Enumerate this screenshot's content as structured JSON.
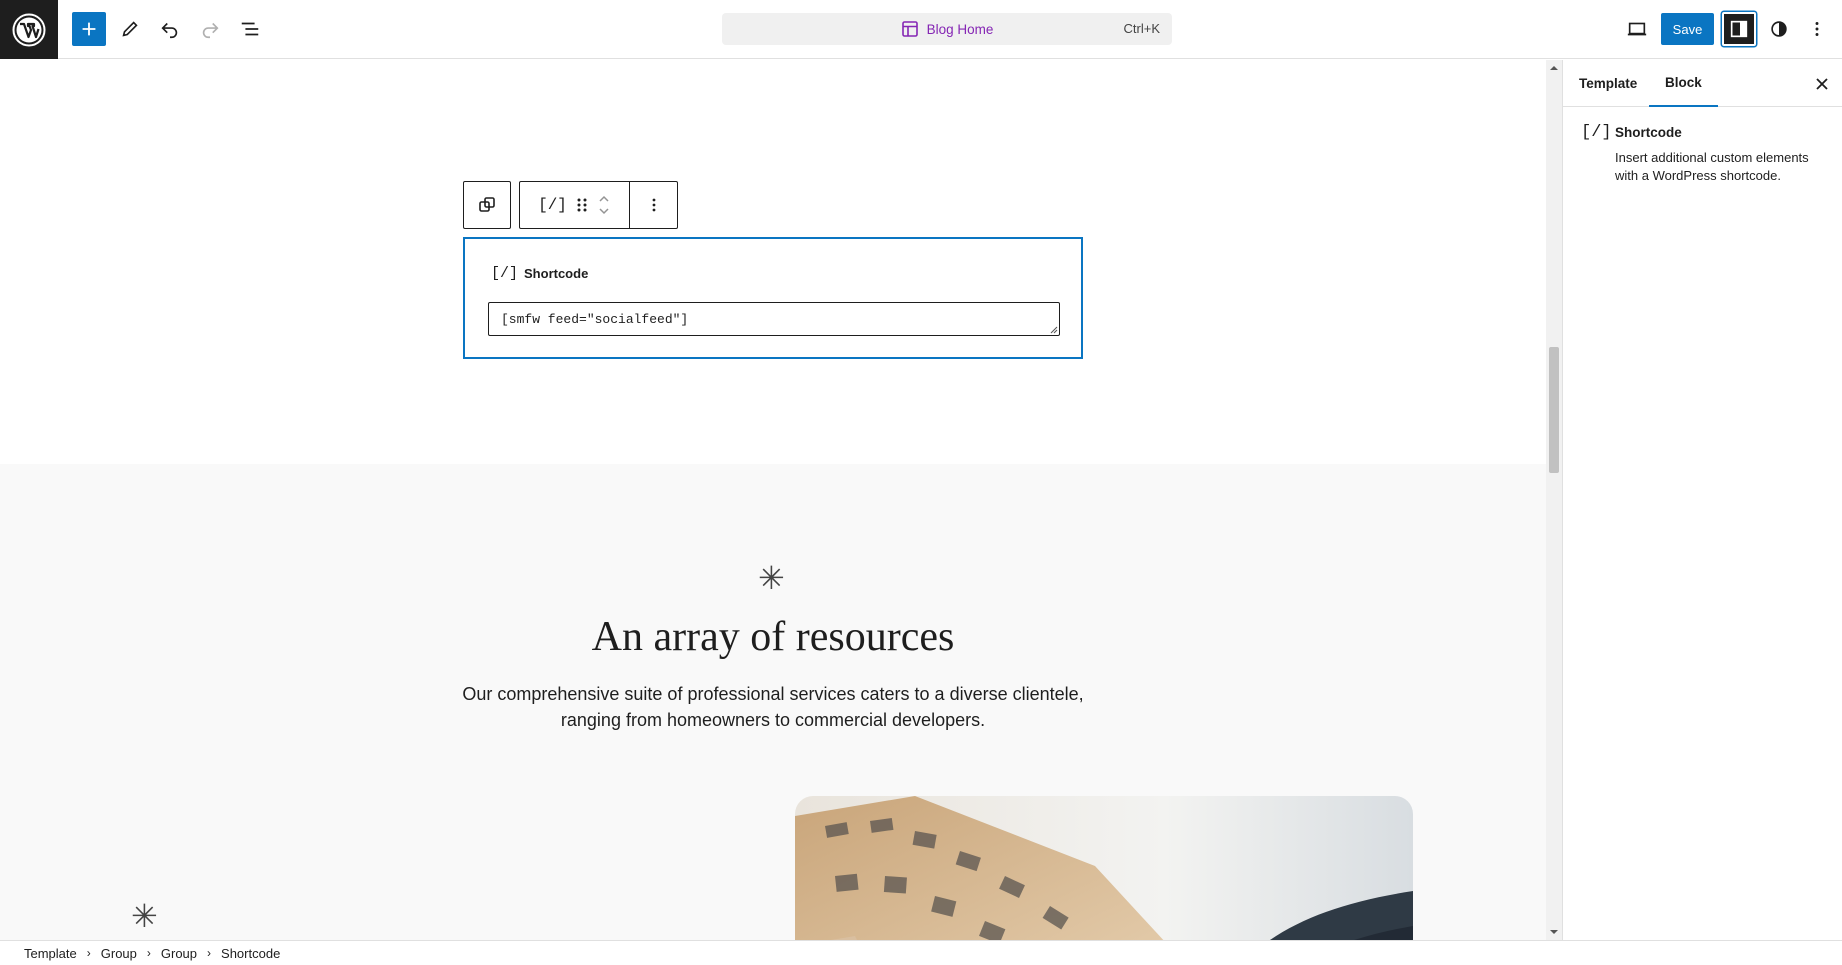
{
  "topbar": {
    "document_title": "Blog Home",
    "shortcut": "Ctrl+K",
    "save_label": "Save"
  },
  "block_toolbar": {
    "block_icon": "[/]"
  },
  "shortcode_block": {
    "icon": "[/]",
    "label": "Shortcode",
    "value": "[smfw feed=\"socialfeed\"]"
  },
  "canvas": {
    "asterisk": "✳",
    "heading": "An array of resources",
    "subtext_line1": "Our comprehensive suite of professional services caters to a diverse clientele,",
    "subtext_line2": "ranging from homeowners to commercial developers."
  },
  "sidebar": {
    "tabs": [
      {
        "label": "Template",
        "active": false
      },
      {
        "label": "Block",
        "active": true
      }
    ],
    "block_card": {
      "icon": "[/]",
      "title": "Shortcode",
      "description": "Insert additional custom elements with a WordPress shortcode."
    }
  },
  "breadcrumbs": [
    "Template",
    "Group",
    "Group",
    "Shortcode"
  ],
  "colors": {
    "accent": "#0a75c2",
    "doc_title": "#8526b4",
    "logo_bg": "#1e1e1e"
  }
}
